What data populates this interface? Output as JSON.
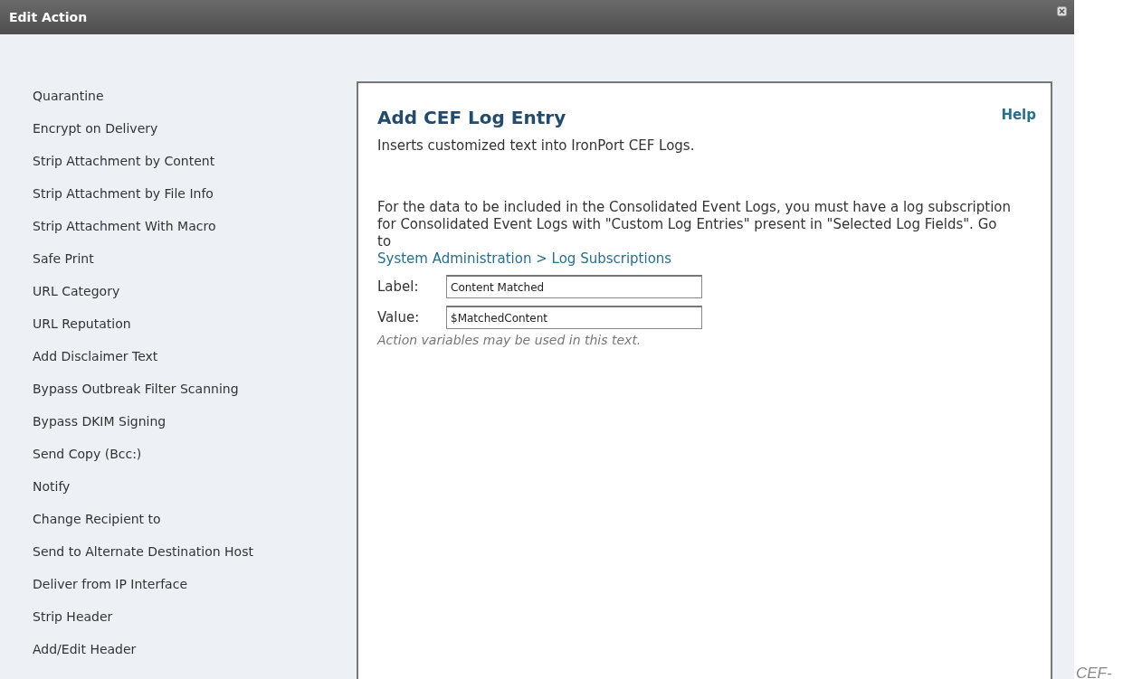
{
  "window": {
    "title": "Edit Action"
  },
  "actions": [
    {
      "label": "Quarantine"
    },
    {
      "label": "Encrypt on Delivery"
    },
    {
      "label": "Strip Attachment by Content"
    },
    {
      "label": "Strip Attachment by File Info"
    },
    {
      "label": "Strip Attachment With Macro"
    },
    {
      "label": "Safe Print"
    },
    {
      "label": "URL Category"
    },
    {
      "label": "URL Reputation"
    },
    {
      "label": "Add Disclaimer Text"
    },
    {
      "label": "Bypass Outbreak Filter Scanning"
    },
    {
      "label": "Bypass DKIM Signing"
    },
    {
      "label": "Send Copy (Bcc:)"
    },
    {
      "label": "Notify"
    },
    {
      "label": "Change Recipient to"
    },
    {
      "label": "Send to Alternate Destination Host"
    },
    {
      "label": "Deliver from IP Interface"
    },
    {
      "label": "Strip Header"
    },
    {
      "label": "Add/Edit Header"
    }
  ],
  "panel": {
    "title": "Add CEF Log Entry",
    "help": "Help",
    "description": "Inserts customized text into IronPort CEF Logs.",
    "note": "For the data to be included in the Consolidated Event Logs, you must have a log subscription for Consolidated Event Logs with \"Custom Log Entries\" present in \"Selected Log Fields\". Go to",
    "link": "System Administration > Log Subscriptions",
    "fields": [
      {
        "label": "Label:",
        "value": "Content Matched"
      },
      {
        "label": "Value:",
        "value": "$MatchedContent"
      }
    ],
    "hint": "Action variables may be used in this text."
  },
  "caption": "CEF-"
}
